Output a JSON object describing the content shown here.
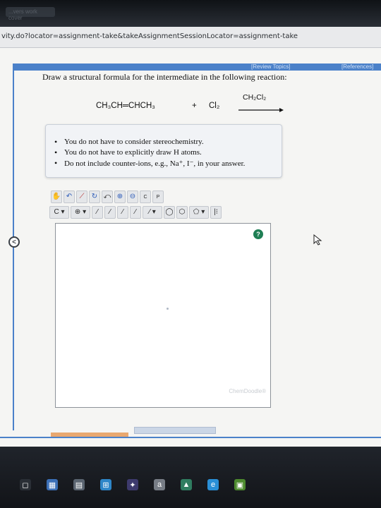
{
  "browser": {
    "tab_title": "...vers work cover",
    "url": "vity.do?locator=assignment-take&takeAssignmentSessionLocator=assignment-take"
  },
  "header": {
    "review_topics": "[Review Topics]",
    "references": "[References]"
  },
  "question": {
    "prompt": "Draw a structural formula for the intermediate in the following reaction:"
  },
  "reaction": {
    "reactant1": "CH₃CH═CHCH₃",
    "plus": "+",
    "reactant2": "Cl₂",
    "solvent": "CH₂Cl₂"
  },
  "hints": {
    "items": [
      "You do not have to consider stereochemistry.",
      "You do not have to explicitly draw H atoms.",
      "Do not include counter-ions, e.g., Na⁺, I⁻, in your answer."
    ]
  },
  "editor": {
    "toolbar_row1": [
      "✋",
      "↶",
      "⟋",
      "↻",
      "⤺",
      "⊕",
      "⊖",
      "C",
      "P"
    ],
    "toolbar_row2": [
      "C ▾",
      "⊕ ▾",
      "⁄",
      "⁄",
      "⁄",
      "⁄",
      "⁄ ▾",
      "◯",
      "⬡",
      "⬠ ▾",
      "|⁝"
    ],
    "help_label": "?",
    "watermark": "ChemDoodle®"
  },
  "sidebar": {
    "collapse_label": "<"
  },
  "taskbar": {
    "icons": [
      "◻",
      "▦",
      "▤",
      "⊞",
      "✦",
      "a",
      "▲",
      "e",
      "▣"
    ]
  },
  "colors": {
    "accent_blue": "#4b81c9",
    "help_green": "#1f7f54",
    "progress_orange": "#e9a86f"
  }
}
